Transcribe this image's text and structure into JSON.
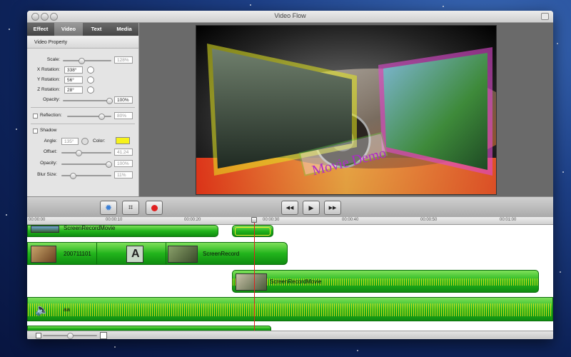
{
  "window": {
    "title": "Video Flow"
  },
  "tabs": [
    {
      "label": "Effect",
      "active": false
    },
    {
      "label": "Video",
      "active": true
    },
    {
      "label": "Text",
      "active": false
    },
    {
      "label": "Media",
      "active": false
    }
  ],
  "video_property": {
    "section_title": "Video Property",
    "scale": {
      "label": "Scale:",
      "value": "128%"
    },
    "x_rotation": {
      "label": "X Rotation:",
      "value": "338°"
    },
    "y_rotation": {
      "label": "Y Rotation:",
      "value": "56°"
    },
    "z_rotation": {
      "label": "Z Rotation:",
      "value": "28°"
    },
    "opacity": {
      "label": "Opacity:",
      "value": "100%"
    }
  },
  "reflection": {
    "label": "Reflection:",
    "value": "80%"
  },
  "shadow": {
    "label": "Shadow",
    "angle": {
      "label": "Angle:",
      "value": "135°"
    },
    "color_label": "Color:",
    "color": "#f6f21a",
    "offset": {
      "label": "Offset:",
      "value": "41.24"
    },
    "opacity": {
      "label": "Opacity:",
      "value": "100%"
    },
    "blur": {
      "label": "Blur Size:",
      "value": "11%"
    }
  },
  "preview": {
    "overlay_text": "Movie Demo"
  },
  "toolbar": {
    "settings_icon": "gear-icon",
    "crop_icon": "crop-icon",
    "record_icon": "record-icon",
    "rewind_glyph": "◀◀",
    "play_glyph": "▶",
    "forward_glyph": "▶▶"
  },
  "ruler": {
    "ticks": [
      "00:00:00",
      "00:00:10",
      "00:00:20",
      "00:00:30",
      "00:00:40",
      "00:00:50",
      "00:01:00"
    ]
  },
  "timeline": {
    "track1_clip": "ScreenRecordMovie",
    "track2": {
      "clip1": "200711101",
      "clip3": "ScreenRecord"
    },
    "track3_clip": "ScreenRecordMovie",
    "track4_clip": "aa"
  },
  "colors": {
    "clip_green": "#22b41c",
    "waveform": "#e6e31a",
    "playhead": "#e02020"
  }
}
